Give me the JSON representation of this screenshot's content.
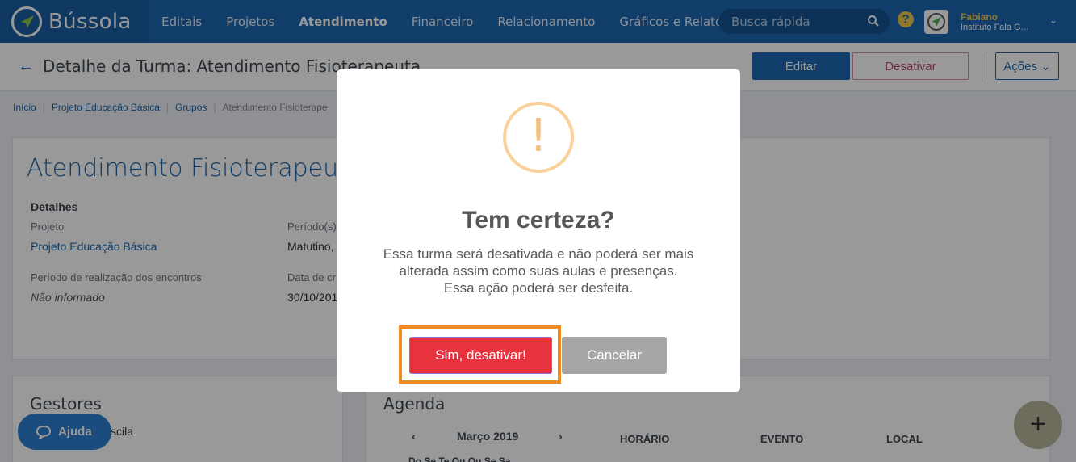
{
  "app": {
    "name": "Bússola"
  },
  "nav": {
    "items": [
      "Editais",
      "Projetos",
      "Atendimento",
      "Financeiro",
      "Relacionamento",
      "Gráficos e Relatórios"
    ],
    "active": "Atendimento"
  },
  "search": {
    "placeholder": "Busca rápida"
  },
  "user": {
    "name": "Fabiano",
    "org": "Instituto Fala G..."
  },
  "header": {
    "title": "Detalhe da Turma: Atendimento Fisioterapeuta",
    "edit_label": "Editar",
    "deactivate_label": "Desativar",
    "actions_label": "Ações"
  },
  "breadcrumb": [
    "Início",
    "Projeto Educação Básica",
    "Grupos",
    "Atendimento Fisioterape"
  ],
  "details": {
    "title": "Atendimento Fisioterapeuta",
    "section": "Detalhes",
    "project_label": "Projeto",
    "project_value": "Projeto Educação Básica",
    "period_label": "Período(s)",
    "period_value": "Matutino,",
    "meeting_period_label": "Período de realização dos encontros",
    "meeting_period_value": "Não informado",
    "created_label": "Data de cr",
    "created_value": "30/10/201"
  },
  "gestores": {
    "title": "Gestores",
    "partial_name": "scila"
  },
  "agenda": {
    "title": "Agenda",
    "month": "Março 2019",
    "columns": [
      "HORÁRIO",
      "EVENTO",
      "LOCAL"
    ],
    "weekdays": "Do Se Te Qu Qu Se Sa"
  },
  "help": {
    "label": "Ajuda"
  },
  "modal": {
    "icon_symbol": "!",
    "title": "Tem certeza?",
    "text_line1": "Essa turma será desativada e não poderá ser mais",
    "text_line2": "alterada assim como suas aulas e presenças.",
    "text_line3": "Essa ação poderá ser desfeita.",
    "confirm_label": "Sim, desativar!",
    "cancel_label": "Cancelar"
  },
  "fab": {
    "symbol": "+"
  },
  "colors": {
    "primary": "#1b67b0",
    "danger": "#e8333f",
    "warning": "#f8d19b",
    "highlight": "#f08a24"
  }
}
